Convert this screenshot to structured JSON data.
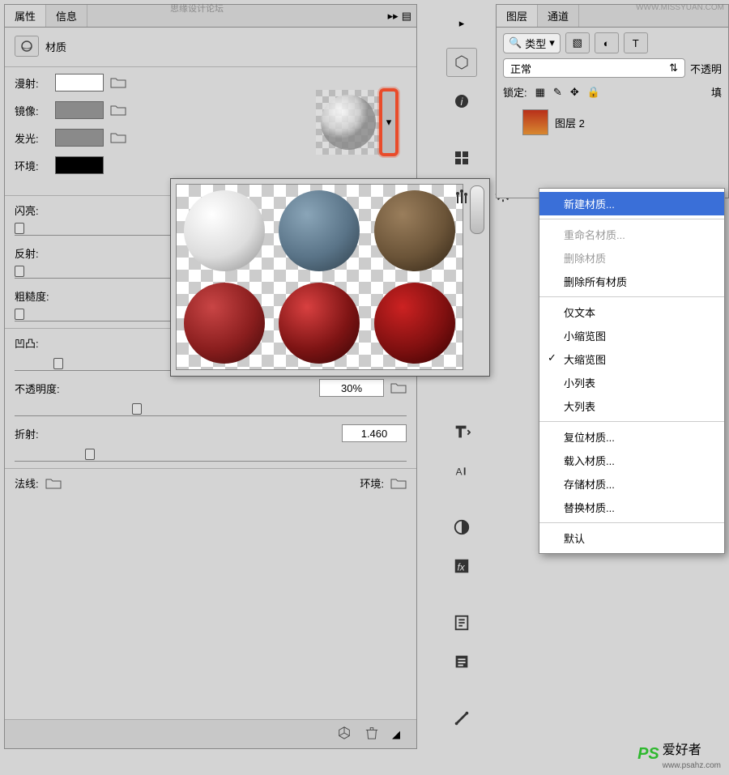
{
  "tabs": {
    "properties": "属性",
    "info": "信息",
    "layers": "图层",
    "channels": "通道"
  },
  "material_header": "材质",
  "props": {
    "diffuse": "漫射:",
    "specular": "镜像:",
    "glow": "发光:",
    "environment": "环境:",
    "swatches": {
      "diffuse": "#ffffff",
      "specular": "#8a8a8a",
      "glow": "#8a8a8a",
      "environment": "#000000"
    }
  },
  "sliders": {
    "shine": "闪亮:",
    "reflection": "反射:",
    "roughness": "粗糙度:",
    "bump": "凹凸:",
    "opacity": "不透明度:",
    "refraction": "折射:"
  },
  "values": {
    "bump": "10%",
    "opacity": "30%",
    "refraction": "1.460"
  },
  "bottom": {
    "normal": "法线:",
    "env": "环境:"
  },
  "layer_panel": {
    "filter_label": "类型",
    "blend_mode": "正常",
    "opacity_label": "不透明",
    "lock_label": "锁定:",
    "fill_label": "填",
    "layer_name": "图层 2"
  },
  "menu": {
    "new": "新建材质...",
    "rename": "重命名材质...",
    "delete": "删除材质",
    "delete_all": "删除所有材质",
    "text_only": "仅文本",
    "small_thumb": "小缩览图",
    "large_thumb": "大缩览图",
    "small_list": "小列表",
    "large_list": "大列表",
    "reset": "复位材质...",
    "load": "载入材质...",
    "save": "存储材质...",
    "replace": "替换材质...",
    "default": "默认"
  },
  "watermark": {
    "top": "思缘设计论坛",
    "topright": "WWW.MISSYUAN.COM",
    "ps": "PS",
    "txt": "爱好者",
    "url": "www.psahz.com"
  }
}
